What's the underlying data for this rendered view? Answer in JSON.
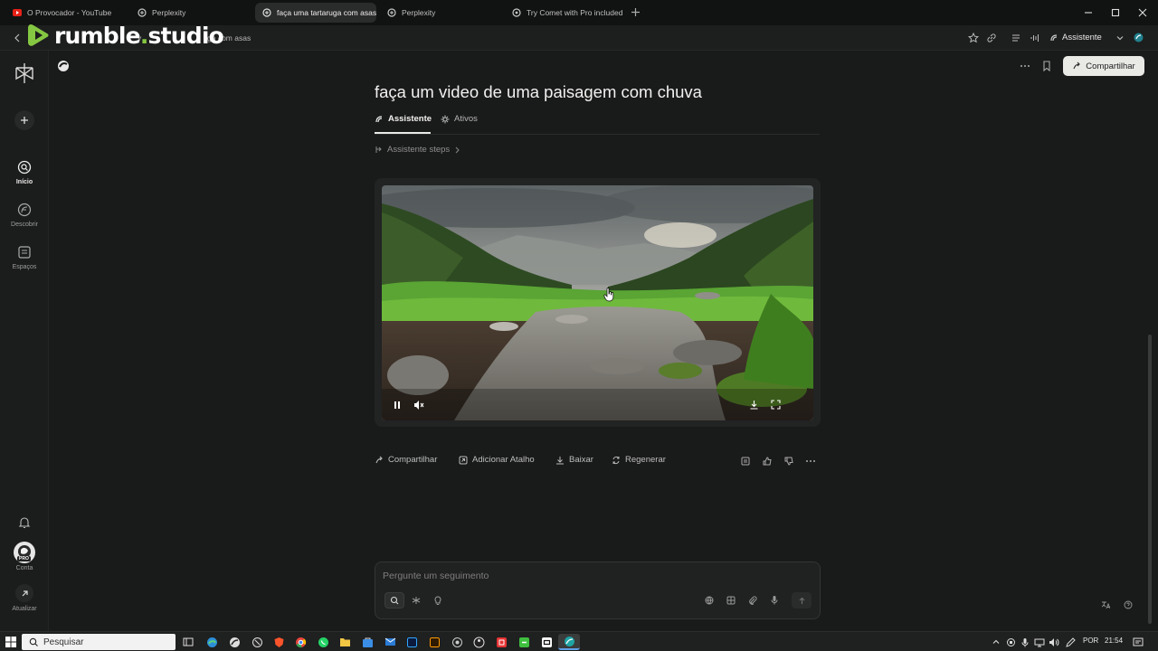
{
  "browser": {
    "tabs": [
      {
        "label": "O Provocador - YouTube",
        "icon": "youtube-icon",
        "active": false
      },
      {
        "label": "Perplexity",
        "icon": "perplexity-icon",
        "active": false
      },
      {
        "label": "faça uma tartaruga com asas",
        "icon": "perplexity-icon",
        "active": true
      },
      {
        "label": "Perplexity",
        "icon": "perplexity-icon",
        "active": false
      },
      {
        "label": "Try Comet with Pro included",
        "icon": "comet-icon",
        "active": false
      }
    ],
    "address_fragment_a": "y",
    "address_fragment_b": "ga com asas",
    "assistant_label": "Assistente"
  },
  "watermark": {
    "brand_a": "rumble",
    "dot": ".",
    "brand_b": "studio",
    "accent_color": "#85c742"
  },
  "sidebar": {
    "items": [
      {
        "label": "Início",
        "icon": "home-search-icon",
        "active": true
      },
      {
        "label": "Descobrir",
        "icon": "discover-icon",
        "active": false
      },
      {
        "label": "Espaços",
        "icon": "spaces-icon",
        "active": false
      }
    ],
    "account_label": "Conta",
    "pro_badge": "PRO",
    "update_label": "Atualizar"
  },
  "main": {
    "share_label": "Compartilhar",
    "query_title": "faça um video de uma paisagem com chuva",
    "tabs": [
      {
        "label": "Assistente",
        "active": true
      },
      {
        "label": "Ativos",
        "active": false
      }
    ],
    "steps_label": "Assistente steps",
    "actions": {
      "share": "Compartilhar",
      "shortcut": "Adicionar Atalho",
      "download": "Baixar",
      "regenerate": "Regenerar"
    },
    "composer_placeholder": "Pergunte um seguimento"
  },
  "taskbar": {
    "search_placeholder": "Pesquisar",
    "language": "POR",
    "time": "21:54"
  },
  "colors": {
    "accent": "#20808d",
    "share_button_bg": "#e9e9e6",
    "background": "#191a1a"
  }
}
